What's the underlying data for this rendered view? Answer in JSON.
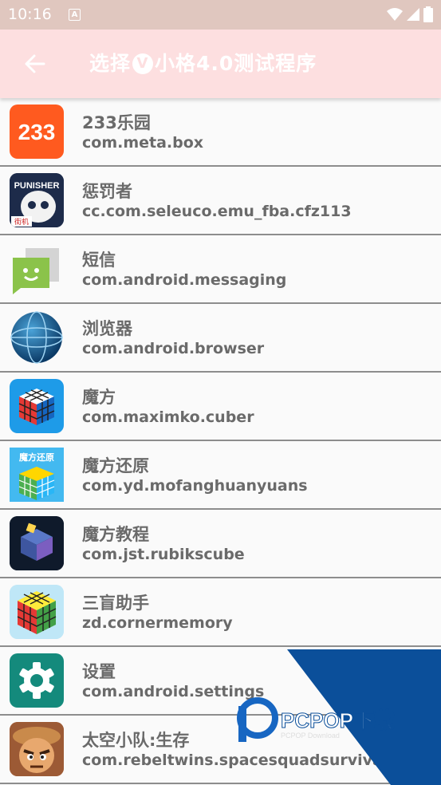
{
  "status": {
    "time": "10:16",
    "notification_letter": "A"
  },
  "appbar": {
    "title_prefix": "选择",
    "title_badge": "V",
    "title_suffix": "小格4.0测试程序"
  },
  "apps": [
    {
      "name": "233乐园",
      "package": "com.meta.box",
      "icon": "233-park-icon",
      "icon_text": "233"
    },
    {
      "name": "惩罚者",
      "package": "cc.com.seleuco.emu_fba.cfz113",
      "icon": "punisher-icon",
      "icon_text": "PUNISHER",
      "icon_badge": "街机"
    },
    {
      "name": "短信",
      "package": "com.android.messaging",
      "icon": "messaging-icon"
    },
    {
      "name": "浏览器",
      "package": "com.android.browser",
      "icon": "browser-globe-icon"
    },
    {
      "name": "魔方",
      "package": "com.maximko.cuber",
      "icon": "rubiks-cube-icon"
    },
    {
      "name": "魔方还原",
      "package": "com.yd.mofanghuanyuans",
      "icon": "cube-restore-icon",
      "icon_text": "魔方还原"
    },
    {
      "name": "魔方教程",
      "package": "com.jst.rubikscube",
      "icon": "cube-tutorial-icon"
    },
    {
      "name": "三盲助手",
      "package": "zd.cornermemory",
      "icon": "blind-solve-cube-icon"
    },
    {
      "name": "设置",
      "package": "com.android.settings",
      "icon": "settings-gear-icon"
    },
    {
      "name": "太空小队:生存",
      "package": "com.rebeltwins.spacesquadsurvival",
      "icon": "space-squad-icon"
    }
  ],
  "watermark": {
    "brand": "PCPOP下载",
    "sub": "PCPOP Download"
  }
}
